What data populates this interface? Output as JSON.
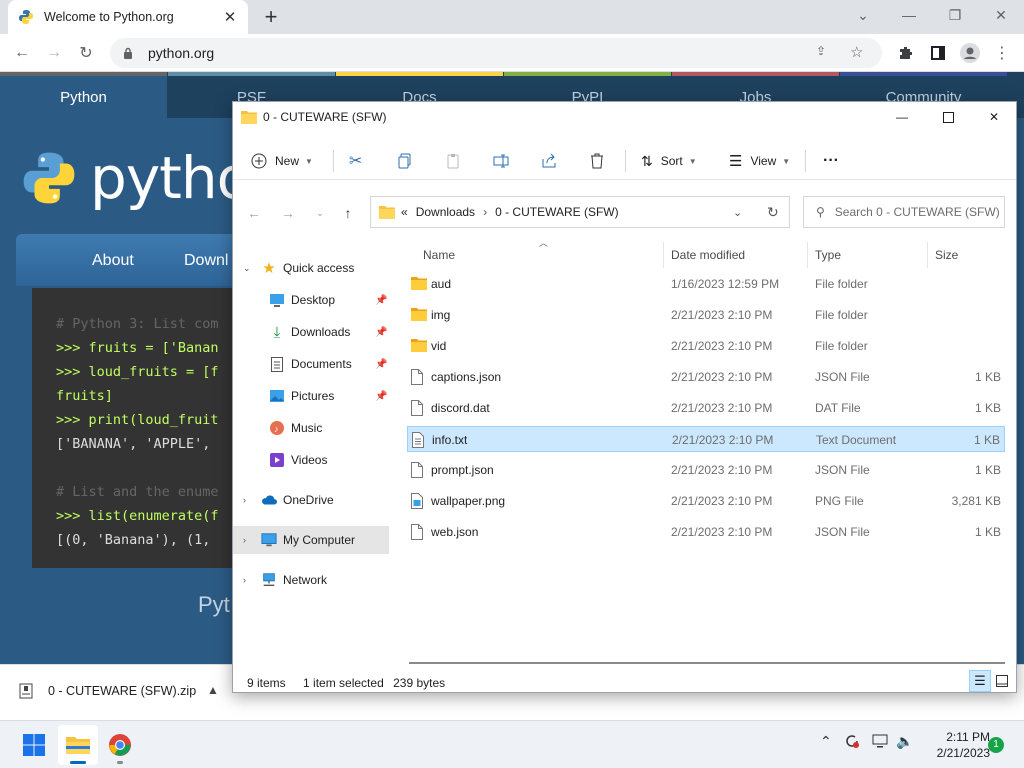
{
  "browser": {
    "tab_title": "Welcome to Python.org",
    "url": "python.org"
  },
  "page": {
    "nav": [
      "Python",
      "PSF",
      "Docs",
      "PyPI",
      "Jobs",
      "Community"
    ],
    "nav_colors": [
      "#646565",
      "#5f8ea5",
      "#ffd343",
      "#82b043",
      "#b55863",
      "#3b4e98"
    ],
    "logo_text": "pytho",
    "menu": [
      "About",
      "Downl"
    ],
    "code_lines": [
      {
        "cls": "c-comment",
        "text": "# Python 3: List com"
      },
      {
        "cls": "c-green",
        "text": ">>> fruits = ['Banan"
      },
      {
        "cls": "c-green",
        "text": ">>> loud_fruits = [f"
      },
      {
        "cls": "c-green",
        "text": "fruits]"
      },
      {
        "cls": "c-green",
        "text": ">>> print(loud_fruit"
      },
      {
        "cls": "c-white",
        "text": "['BANANA', 'APPLE', "
      },
      {
        "cls": "c-white",
        "text": ""
      },
      {
        "cls": "c-comment",
        "text": "# List and the enume"
      },
      {
        "cls": "c-green",
        "text": ">>> list(enumerate(f"
      },
      {
        "cls": "c-white",
        "text": "[(0, 'Banana'), (1, "
      }
    ],
    "foot_text": "Pyt"
  },
  "download": {
    "filename": "0 - CUTEWARE (SFW).zip"
  },
  "explorer": {
    "title": "0 - CUTEWARE (SFW)",
    "cmd": {
      "new": "New",
      "sort": "Sort",
      "view": "View",
      "more": "···"
    },
    "address": {
      "prefix": "«",
      "crumbs": [
        "Downloads",
        "0 - CUTEWARE (SFW)"
      ]
    },
    "search_placeholder": "Search 0 - CUTEWARE (SFW)",
    "nav": {
      "quick_access": "Quick access",
      "desktop": "Desktop",
      "downloads": "Downloads",
      "documents": "Documents",
      "pictures": "Pictures",
      "music": "Music",
      "videos": "Videos",
      "onedrive": "OneDrive",
      "my_computer": "My Computer",
      "network": "Network"
    },
    "columns": {
      "name": "Name",
      "date": "Date modified",
      "type": "Type",
      "size": "Size"
    },
    "files": [
      {
        "name": "aud",
        "date": "1/16/2023 12:59 PM",
        "type": "File folder",
        "size": "",
        "icon": "folder"
      },
      {
        "name": "img",
        "date": "2/21/2023 2:10 PM",
        "type": "File folder",
        "size": "",
        "icon": "folder"
      },
      {
        "name": "vid",
        "date": "2/21/2023 2:10 PM",
        "type": "File folder",
        "size": "",
        "icon": "folder"
      },
      {
        "name": "captions.json",
        "date": "2/21/2023 2:10 PM",
        "type": "JSON File",
        "size": "1 KB",
        "icon": "file"
      },
      {
        "name": "discord.dat",
        "date": "2/21/2023 2:10 PM",
        "type": "DAT File",
        "size": "1 KB",
        "icon": "file"
      },
      {
        "name": "info.txt",
        "date": "2/21/2023 2:10 PM",
        "type": "Text Document",
        "size": "1 KB",
        "icon": "text"
      },
      {
        "name": "prompt.json",
        "date": "2/21/2023 2:10 PM",
        "type": "JSON File",
        "size": "1 KB",
        "icon": "file"
      },
      {
        "name": "wallpaper.png",
        "date": "2/21/2023 2:10 PM",
        "type": "PNG File",
        "size": "3,281 KB",
        "icon": "image"
      },
      {
        "name": "web.json",
        "date": "2/21/2023 2:10 PM",
        "type": "JSON File",
        "size": "1 KB",
        "icon": "file"
      }
    ],
    "selected_index": 5,
    "status": {
      "items": "9 items",
      "selected": "1 item selected",
      "size": "239 bytes"
    }
  },
  "taskbar": {
    "time": "2:11 PM",
    "date": "2/21/2023",
    "notifications": "1"
  }
}
